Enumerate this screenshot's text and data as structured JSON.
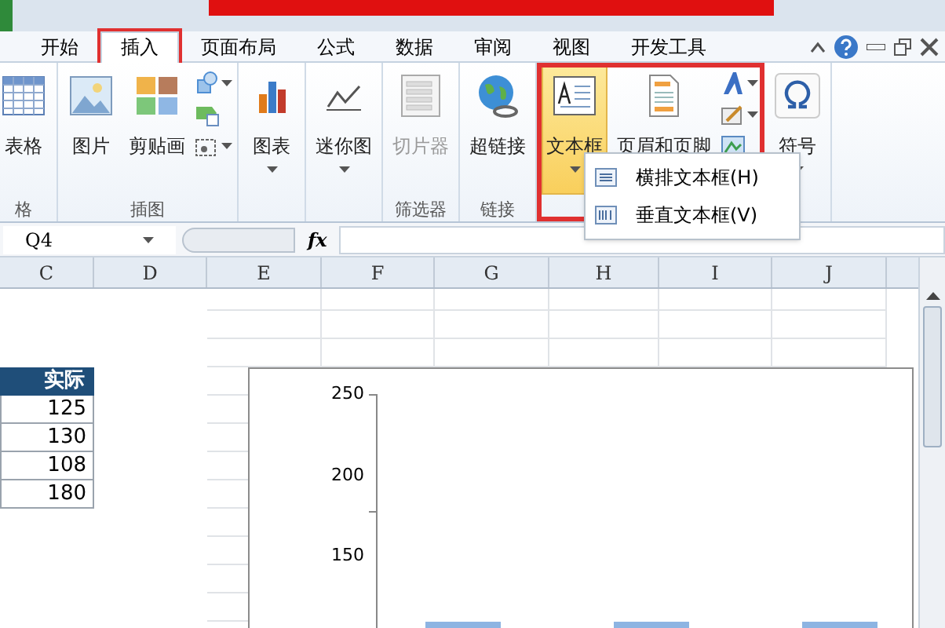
{
  "tabs": [
    {
      "label": "开始",
      "selected": false,
      "annotated": false
    },
    {
      "label": "插入",
      "selected": true,
      "annotated": true
    },
    {
      "label": "页面布局",
      "selected": false,
      "annotated": false
    },
    {
      "label": "公式",
      "selected": false,
      "annotated": false
    },
    {
      "label": "数据",
      "selected": false,
      "annotated": false
    },
    {
      "label": "审阅",
      "selected": false,
      "annotated": false
    },
    {
      "label": "视图",
      "selected": false,
      "annotated": false
    },
    {
      "label": "开发工具",
      "selected": false,
      "annotated": false
    }
  ],
  "ribbon": {
    "groups": [
      {
        "label": "格",
        "annotated": false,
        "buttons": [
          {
            "kind": "large",
            "label": "表格",
            "dropdown": false,
            "disabled": false,
            "selected": false
          }
        ]
      },
      {
        "label": "插图",
        "annotated": false,
        "buttons": [
          {
            "kind": "large",
            "label": "图片",
            "dropdown": false,
            "disabled": false,
            "selected": false
          },
          {
            "kind": "large",
            "label": "剪贴画",
            "dropdown": false,
            "disabled": false,
            "selected": false
          },
          {
            "kind": "stack",
            "items": [
              {
                "dropdown": true
              },
              {
                "dropdown": false
              },
              {
                "dropdown": true
              }
            ]
          }
        ]
      },
      {
        "annotated": false,
        "buttons": [
          {
            "kind": "large",
            "label": "图表",
            "dropdown": true,
            "disabled": false,
            "selected": false
          }
        ]
      },
      {
        "annotated": false,
        "buttons": [
          {
            "kind": "large",
            "label": "迷你图",
            "dropdown": true,
            "disabled": false,
            "selected": false
          }
        ]
      },
      {
        "label": "筛选器",
        "annotated": false,
        "buttons": [
          {
            "kind": "large",
            "label": "切片器",
            "dropdown": false,
            "disabled": true,
            "selected": false
          }
        ]
      },
      {
        "label": "链接",
        "annotated": false,
        "buttons": [
          {
            "kind": "large",
            "label": "超链接",
            "dropdown": false,
            "disabled": false,
            "selected": false
          }
        ]
      },
      {
        "annotated": true,
        "buttons": [
          {
            "kind": "large",
            "label": "文本框",
            "dropdown": true,
            "disabled": false,
            "selected": true
          },
          {
            "kind": "large",
            "label": "页眉和页脚",
            "dropdown": false,
            "disabled": false,
            "selected": false
          },
          {
            "kind": "stack",
            "items": [
              {
                "dropdown": true
              },
              {
                "dropdown": true
              },
              {
                "dropdown": false
              }
            ]
          }
        ]
      },
      {
        "annotated": false,
        "buttons": [
          {
            "kind": "large",
            "label": "符号",
            "dropdown": true,
            "disabled": false,
            "selected": false
          }
        ]
      }
    ]
  },
  "menu": {
    "items": [
      {
        "label": "横排文本框(H)"
      },
      {
        "label": "垂直文本框(V)"
      }
    ]
  },
  "formula_bar": {
    "name_box": "Q4",
    "function_label": "fx"
  },
  "columns": [
    "C",
    "D",
    "E",
    "F",
    "G",
    "H",
    "I",
    "J"
  ],
  "table": {
    "header": "实际",
    "values": [
      "125",
      "130",
      "108",
      "180"
    ]
  },
  "chart": {
    "y_axis_labels": [
      "250",
      "200",
      "150"
    ]
  }
}
